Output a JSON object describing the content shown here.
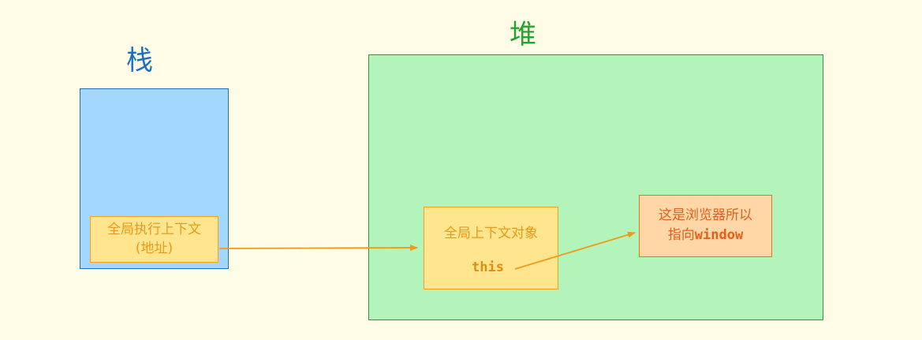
{
  "stack": {
    "title": "栈",
    "exec_context": {
      "line1": "全局执行上下文",
      "line2": "(地址)"
    }
  },
  "heap": {
    "title": "堆",
    "global_object": {
      "title": "全局上下文对象",
      "this_keyword": "this"
    },
    "window_note": {
      "line1": "这是浏览器所以",
      "line2_prefix": "指向",
      "line2_code": "window"
    }
  },
  "colors": {
    "background": "#fefce6",
    "stack_fill": "#a4d7ff",
    "stack_border": "#1f6fc4",
    "heap_fill": "#b3f4bb",
    "heap_border": "#2a9a3a",
    "context_fill": "#ffe68e",
    "context_border": "#efa21d",
    "note_fill": "#ffd6a6",
    "note_border": "#e8731d",
    "arrow": "#ef9a1a"
  }
}
